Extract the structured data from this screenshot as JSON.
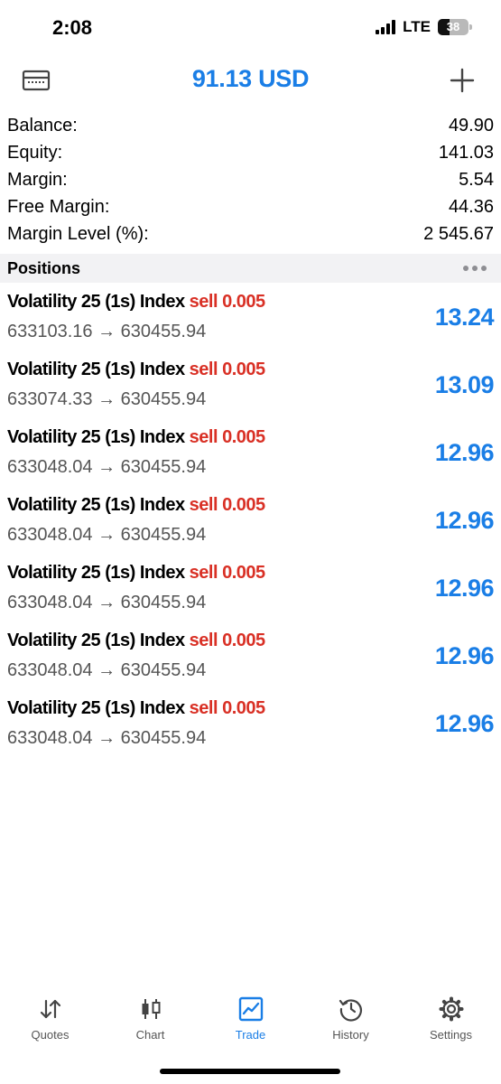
{
  "status_bar": {
    "time": "2:08",
    "network": "LTE",
    "battery_level": "38"
  },
  "header": {
    "title": "91.13 USD",
    "left_icon": "account-card-icon",
    "right_icon": "plus-icon"
  },
  "summary": [
    {
      "label": "Balance:",
      "value": "49.90"
    },
    {
      "label": "Equity:",
      "value": "141.03"
    },
    {
      "label": "Margin:",
      "value": "5.54"
    },
    {
      "label": "Free Margin:",
      "value": "44.36"
    },
    {
      "label": "Margin Level (%):",
      "value": "2 545.67"
    }
  ],
  "positions_section": {
    "title": "Positions"
  },
  "positions": [
    {
      "symbol": "Volatility 25 (1s) Index",
      "side": "sell 0.005",
      "prices": "633103.16 → 630455.94",
      "profit": "13.24"
    },
    {
      "symbol": "Volatility 25 (1s) Index",
      "side": "sell 0.005",
      "prices": "633074.33 → 630455.94",
      "profit": "13.09"
    },
    {
      "symbol": "Volatility 25 (1s) Index",
      "side": "sell 0.005",
      "prices": "633048.04 → 630455.94",
      "profit": "12.96"
    },
    {
      "symbol": "Volatility 25 (1s) Index",
      "side": "sell 0.005",
      "prices": "633048.04 → 630455.94",
      "profit": "12.96"
    },
    {
      "symbol": "Volatility 25 (1s) Index",
      "side": "sell 0.005",
      "prices": "633048.04 → 630455.94",
      "profit": "12.96"
    },
    {
      "symbol": "Volatility 25 (1s) Index",
      "side": "sell 0.005",
      "prices": "633048.04 → 630455.94",
      "profit": "12.96"
    },
    {
      "symbol": "Volatility 25 (1s) Index",
      "side": "sell 0.005",
      "prices": "633048.04 → 630455.94",
      "profit": "12.96"
    }
  ],
  "tabs": [
    {
      "label": "Quotes",
      "icon": "quotes-arrows-icon",
      "active": false
    },
    {
      "label": "Chart",
      "icon": "candlestick-icon",
      "active": false
    },
    {
      "label": "Trade",
      "icon": "trade-chart-icon",
      "active": true
    },
    {
      "label": "History",
      "icon": "history-clock-icon",
      "active": false
    },
    {
      "label": "Settings",
      "icon": "gear-icon",
      "active": false
    }
  ],
  "colors": {
    "accent": "#1a7ee6",
    "sell": "#d93025",
    "section_bg": "#f2f2f4",
    "secondary_text": "#555555"
  }
}
